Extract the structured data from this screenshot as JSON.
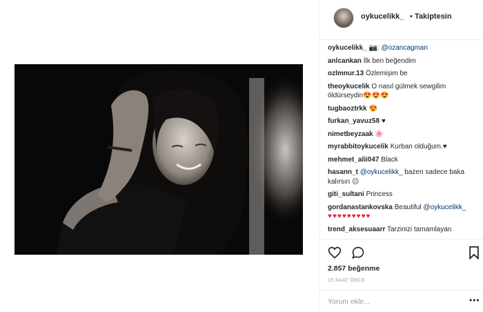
{
  "post": {
    "author": "oykucelikk_",
    "follow_dot": "•",
    "follow_status": "Takiptesin"
  },
  "photo": {
    "alt": ""
  },
  "caption": {
    "user": "oykucelikk_",
    "text": "📷: ",
    "mention": "@ozancagman"
  },
  "comments": [
    {
      "user": "anlcankan",
      "text": "İlk ben beğendim"
    },
    {
      "user": "ozlmnur.13",
      "text": "Özlemişim be"
    },
    {
      "user": "theoykucelik",
      "text": "O nasıl gülmek sewgilim öldürseydin😍😍😍"
    },
    {
      "user": "tugbaoztrkk",
      "text": "😍"
    },
    {
      "user": "furkan_yavuz58",
      "text": "♥"
    },
    {
      "user": "nimetbeyzaak",
      "text": "🌸"
    },
    {
      "user": "myrabbitoykucelik",
      "text": "Kurban olduğum.♥"
    },
    {
      "user": "mehmet_alii047",
      "text": "Black"
    },
    {
      "user": "hasann_t",
      "mention": "@oykucelikk_",
      "text": " bazen sadece baka kalırsın ☹"
    },
    {
      "user": "giti_sultani",
      "text": "Princess"
    },
    {
      "user": "gordanastankovska",
      "text": "Beautiful ",
      "mention": "@oykucelikk_",
      "hearts": "♥♥♥♥♥♥♥♥♥"
    },
    {
      "user": "trend_aksesuaarr",
      "text": "Tarzinizi tamamlayan"
    }
  ],
  "actions": {
    "like_icon": "heart-outline-icon",
    "comment_icon": "speech-bubble-icon",
    "save_icon": "bookmark-icon"
  },
  "likes": "2.857 beğenme",
  "time": "15 SAAT ÖNCE",
  "comment_input": {
    "placeholder": "Yorum ekle..."
  },
  "more_icon": "•••",
  "colors": {
    "heart": "#ed1c3c",
    "mention": "#003569",
    "muted": "#999999",
    "border": "#efefef"
  }
}
